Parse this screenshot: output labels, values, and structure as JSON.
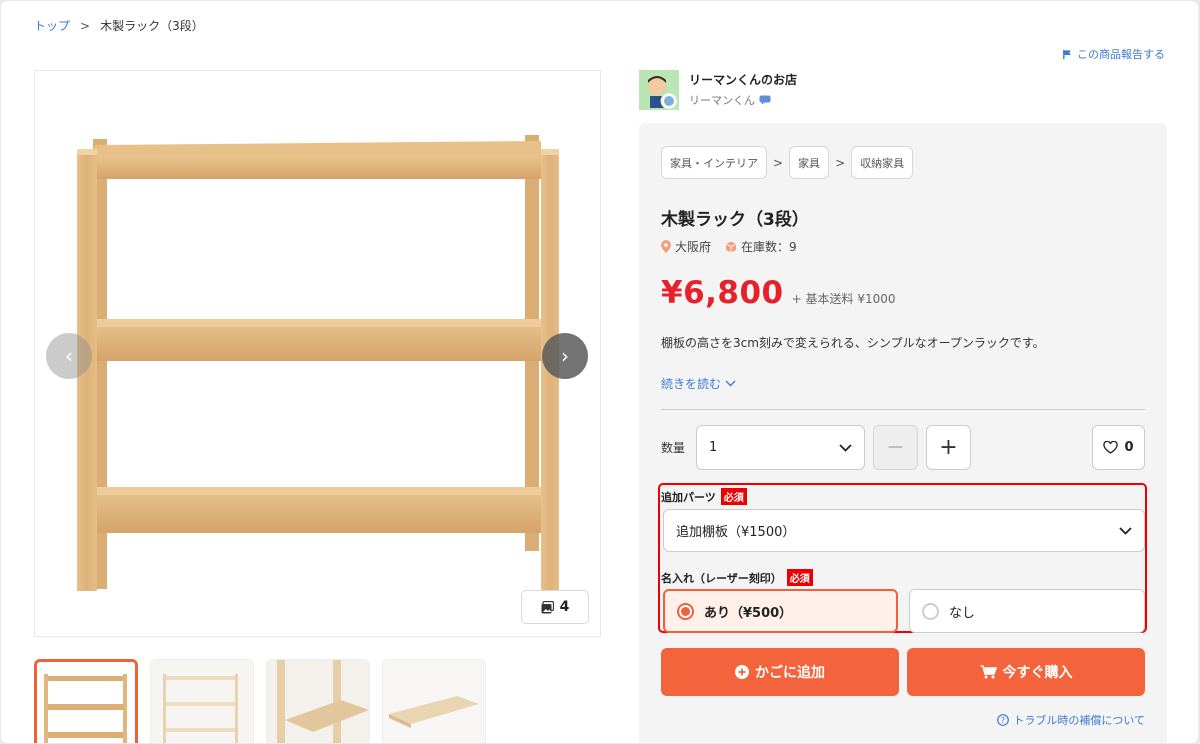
{
  "breadcrumb": {
    "home": "トップ",
    "sep": ">",
    "current": "木製ラック（3段）"
  },
  "report_label": "この商品報告する",
  "gallery": {
    "image_count": "4",
    "prev_label": "‹",
    "next_label": "›"
  },
  "shop": {
    "name": "リーマンくんのお店",
    "owner": "リーマンくん"
  },
  "categories": [
    "家具・インテリア",
    "家具",
    "収納家具"
  ],
  "category_sep": ">",
  "product": {
    "title": "木製ラック（3段）",
    "location": "大阪府",
    "stock": "在庫数：9",
    "price": "¥6,800",
    "shipping": "+ 基本送料 ¥1000",
    "description": "棚板の高さを3cm刻みで変えられる、シンプルなオープンラックです。",
    "read_more": "続きを読む"
  },
  "quantity": {
    "label": "数量",
    "value": "1",
    "minus": "−",
    "plus": "+"
  },
  "favorite_count": "0",
  "options": {
    "parts_label": "追加パーツ",
    "required": "必須",
    "parts_value": "追加棚板（¥1500）",
    "engrave_label": "名入れ（レーザー刻印）",
    "choice_yes": "あり（¥500）",
    "choice_no": "なし",
    "selected": "yes"
  },
  "actions": {
    "add_to_cart": "かごに追加",
    "buy_now": "今すぐ購入"
  },
  "trouble_link": "トラブル時の補償について",
  "colors": {
    "accent": "#f4643c",
    "price": "#e8202a",
    "link": "#3a7bd5",
    "required": "#ee0000"
  }
}
